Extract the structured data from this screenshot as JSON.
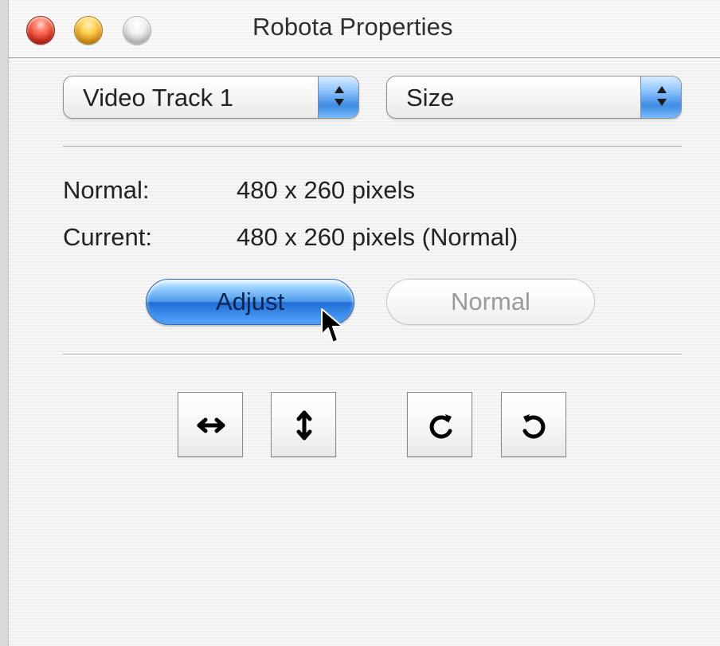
{
  "window": {
    "title": "Robota Properties"
  },
  "controls": {
    "track_select": "Video Track 1",
    "property_select": "Size"
  },
  "info": {
    "normal_label": "Normal:",
    "normal_value": "480 x 260 pixels",
    "current_label": "Current:",
    "current_value": "480 x 260 pixels (Normal)"
  },
  "buttons": {
    "adjust": "Adjust",
    "normal": "Normal"
  },
  "toolbar": {
    "items": [
      {
        "icon": "horizontal-flip-icon"
      },
      {
        "icon": "vertical-flip-icon"
      },
      {
        "icon": "rotate-clockwise-icon"
      },
      {
        "icon": "rotate-counterclockwise-icon"
      }
    ]
  },
  "colors": {
    "accent_blue": "#3f8de3",
    "close": "#df2f1c",
    "minimize": "#f0a21a",
    "disabled_text": "#9a9a9a"
  }
}
